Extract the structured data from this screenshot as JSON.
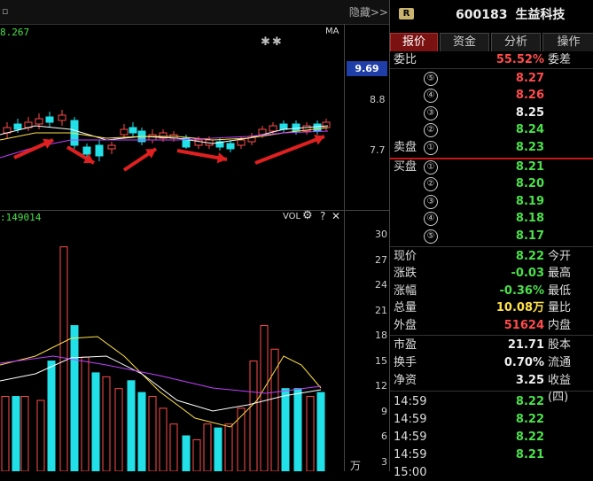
{
  "chart_header": {
    "price_readout": "8.267",
    "ma_label": "MA",
    "stars": "✱✱",
    "hide_label": "隐藏>>"
  },
  "price_axis": {
    "tag_value": "9.69",
    "ticks": [
      "8.8",
      "7.7"
    ]
  },
  "volume_header": {
    "readout": ":149014",
    "vol_label": "VOL",
    "gear": "⚙",
    "help": "?",
    "close": "✕"
  },
  "volume_axis": {
    "ticks": [
      "30",
      "27",
      "24",
      "21",
      "18",
      "15",
      "12",
      "9",
      "6",
      "3"
    ],
    "unit": "万"
  },
  "stock": {
    "badge": "R",
    "code": "600183",
    "name": "生益科技"
  },
  "tabs": [
    {
      "label": "报价",
      "active": true
    },
    {
      "label": "资金",
      "active": false
    },
    {
      "label": "分析",
      "active": false
    },
    {
      "label": "操作",
      "active": false
    }
  ],
  "ratio": {
    "label": "委比",
    "value": "55.52%",
    "label2": "委差"
  },
  "sell_orders": [
    {
      "num": "⑤",
      "price": "8.27",
      "color": "#ff4b4b"
    },
    {
      "num": "④",
      "price": "8.26",
      "color": "#ff4b4b"
    },
    {
      "num": "③",
      "price": "8.25",
      "color": "#eeeeee"
    },
    {
      "num": "②",
      "price": "8.24",
      "color": "#4ae04a"
    },
    {
      "label": "卖盘",
      "num": "①",
      "price": "8.23",
      "color": "#4ae04a"
    }
  ],
  "buy_orders": [
    {
      "label": "买盘",
      "num": "①",
      "price": "8.21",
      "color": "#4ae04a"
    },
    {
      "num": "②",
      "price": "8.20",
      "color": "#4ae04a"
    },
    {
      "num": "③",
      "price": "8.19",
      "color": "#4ae04a"
    },
    {
      "num": "④",
      "price": "8.18",
      "color": "#4ae04a"
    },
    {
      "num": "⑤",
      "price": "8.17",
      "color": "#4ae04a"
    }
  ],
  "quote": [
    {
      "label": "现价",
      "value": "8.22",
      "color": "#4ae04a",
      "label2": "今开"
    },
    {
      "label": "涨跌",
      "value": "-0.03",
      "color": "#4ae04a",
      "label2": "最高"
    },
    {
      "label": "涨幅",
      "value": "-0.36%",
      "color": "#4ae04a",
      "label2": "最低"
    },
    {
      "label": "总量",
      "value": "10.08万",
      "color": "#ffe14a",
      "label2": "量比"
    },
    {
      "label": "外盘",
      "value": "51624",
      "color": "#ff4b4b",
      "label2": "内盘"
    }
  ],
  "fundamentals": [
    {
      "label": "市盈",
      "value": "21.71",
      "label2": "股本"
    },
    {
      "label": "换手",
      "value": "0.70%",
      "label2": "流通"
    },
    {
      "label": "净资",
      "value": "3.25",
      "label2": "收益(四)"
    }
  ],
  "ticks": [
    {
      "time": "14:59",
      "price": "8.22"
    },
    {
      "time": "14:59",
      "price": "8.22"
    },
    {
      "time": "14:59",
      "price": "8.22"
    },
    {
      "time": "14:59",
      "price": "8.21"
    },
    {
      "time": "15:00",
      "price": ""
    }
  ],
  "colors": {
    "up": "#ff4b4b",
    "down": "#22e0e8",
    "ma5": "#ffffff",
    "ma10": "#ffe14a",
    "ma20": "#c040ff",
    "annotation_arrow": "#e02020"
  }
}
